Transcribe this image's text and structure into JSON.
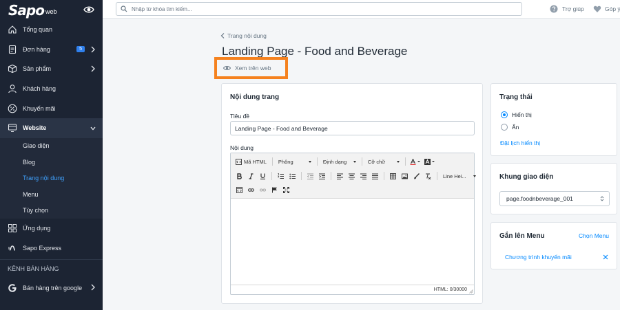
{
  "brand": {
    "logo": "Sapo",
    "logo_sub": "web"
  },
  "sidebar": {
    "items": [
      {
        "label": "Tổng quan",
        "icon": "home-icon"
      },
      {
        "label": "Đơn hàng",
        "icon": "orders-icon",
        "badge": "5"
      },
      {
        "label": "Sản phẩm",
        "icon": "box-icon"
      },
      {
        "label": "Khách hàng",
        "icon": "user-icon"
      },
      {
        "label": "Khuyến mãi",
        "icon": "percent-icon"
      },
      {
        "label": "Website",
        "icon": "monitor-icon"
      }
    ],
    "website_sub": [
      "Giao diện",
      "Blog",
      "Trang nội dung",
      "Menu",
      "Tùy chọn"
    ],
    "after": [
      {
        "label": "Ứng dụng",
        "icon": "apps-icon"
      },
      {
        "label": "Sapo Express",
        "icon": "express-icon"
      }
    ],
    "channels_title": "KÊNH BÁN HÀNG",
    "channel": {
      "label": "Bán hàng trên google",
      "icon": "google-icon"
    }
  },
  "topbar": {
    "search_placeholder": "Nhập từ khóa tìm kiếm...",
    "help": "Trợ giúp",
    "feedback": "Góp ý"
  },
  "page": {
    "breadcrumb": "Trang nội dung",
    "title": "Landing Page - Food and Beverage",
    "view_link": "Xem trên web"
  },
  "content_card": {
    "title": "Nội dung trang",
    "title_label": "Tiêu đề",
    "title_value": "Landing Page - Food and Beverage",
    "content_label": "Nội dung",
    "editor": {
      "html_btn": "Mã HTML",
      "font": "Phông",
      "format": "Định dạng",
      "size": "Cỡ chữ",
      "line_height": "Line Hei...",
      "counter": "HTML: 0/30000"
    }
  },
  "status_card": {
    "title": "Trạng thái",
    "options": [
      "Hiển thị",
      "Ẩn"
    ],
    "selected": "Hiển thị",
    "schedule_link": "Đặt lịch hiển thị"
  },
  "theme_card": {
    "title": "Khung giao diện",
    "selected": "page.foodnbeverage_001"
  },
  "menu_card": {
    "title": "Gắn lên Menu",
    "choose": "Chọn Menu",
    "item": "Chương trình khuyến mãi"
  },
  "colors": {
    "sidebar_bg": "#1c2433",
    "accent": "#0088ff",
    "highlight": "#f5821f"
  }
}
